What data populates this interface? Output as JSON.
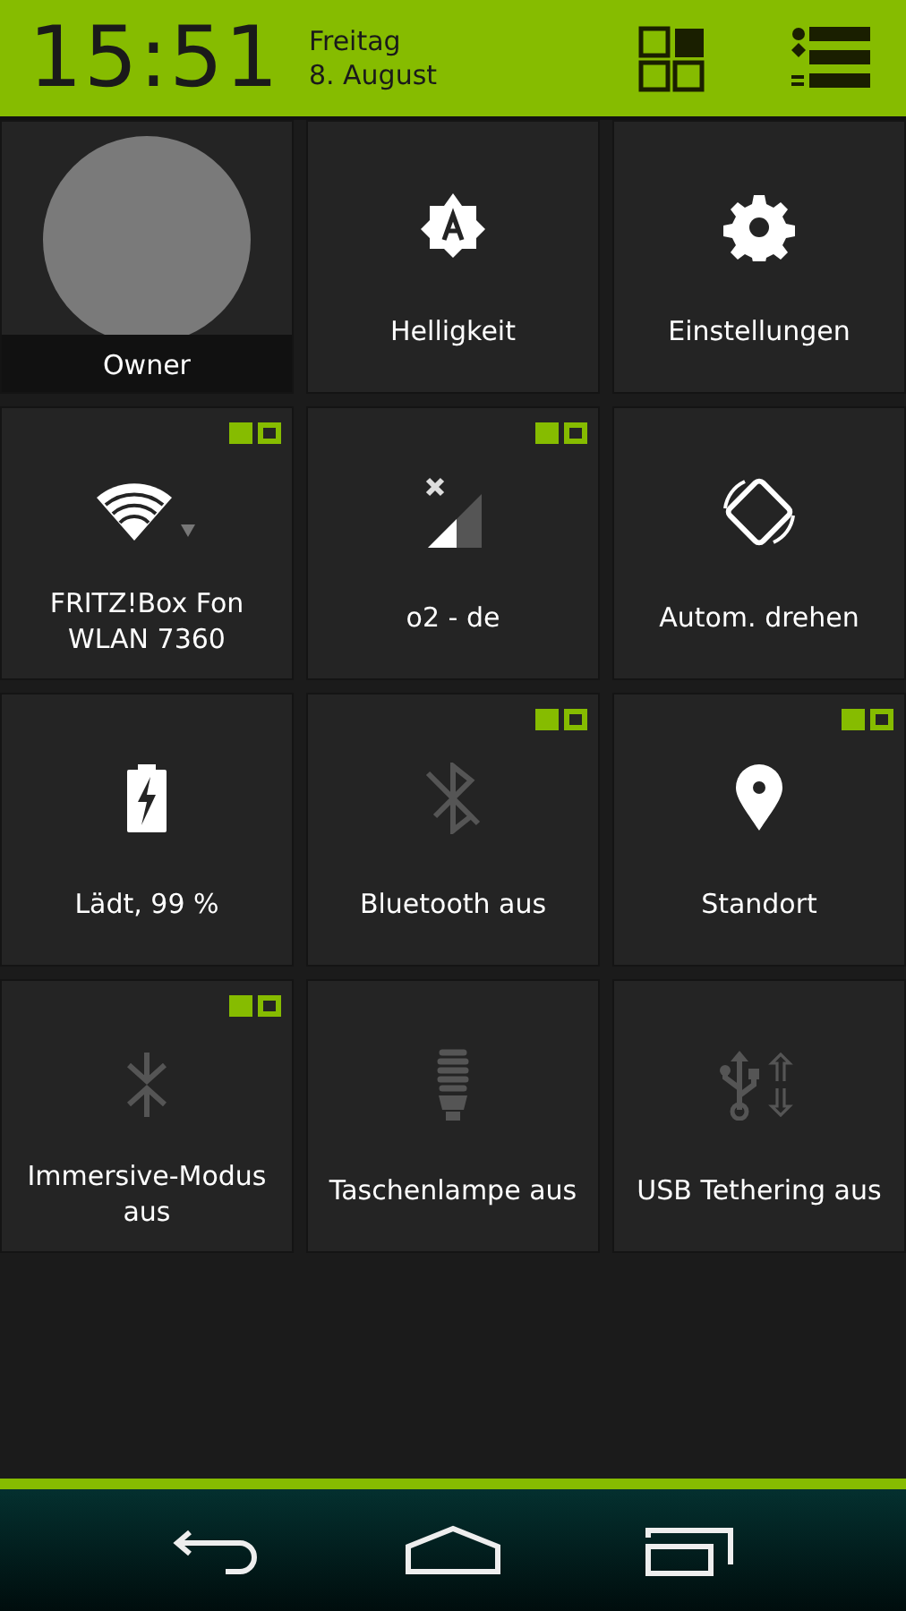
{
  "header": {
    "time": "15:51",
    "day": "Freitag",
    "date": "8. August"
  },
  "user": {
    "name": "Owner"
  },
  "tiles": [
    {
      "kind": "brightness",
      "label": "Helligkeit",
      "on": true,
      "toggle": false
    },
    {
      "kind": "settings",
      "label": "Einstellungen",
      "on": true,
      "toggle": false
    },
    {
      "kind": "wifi",
      "label": "FRITZ!Box Fon WLAN 7360",
      "on": true,
      "toggle": true
    },
    {
      "kind": "signal",
      "label": "o2 - de",
      "on": true,
      "toggle": true
    },
    {
      "kind": "rotate",
      "label": "Autom. drehen",
      "on": true,
      "toggle": false
    },
    {
      "kind": "battery",
      "label": "Lädt, 99 %",
      "on": true,
      "toggle": false
    },
    {
      "kind": "bluetooth",
      "label": "Bluetooth aus",
      "on": false,
      "toggle": true
    },
    {
      "kind": "location",
      "label": "Standort",
      "on": true,
      "toggle": true
    },
    {
      "kind": "immersive",
      "label": "Immersive-Modus aus",
      "on": false,
      "toggle": true
    },
    {
      "kind": "flashlight",
      "label": "Taschenlampe aus",
      "on": false,
      "toggle": false
    },
    {
      "kind": "usb",
      "label": "USB Tethering aus",
      "on": false,
      "toggle": false
    }
  ]
}
